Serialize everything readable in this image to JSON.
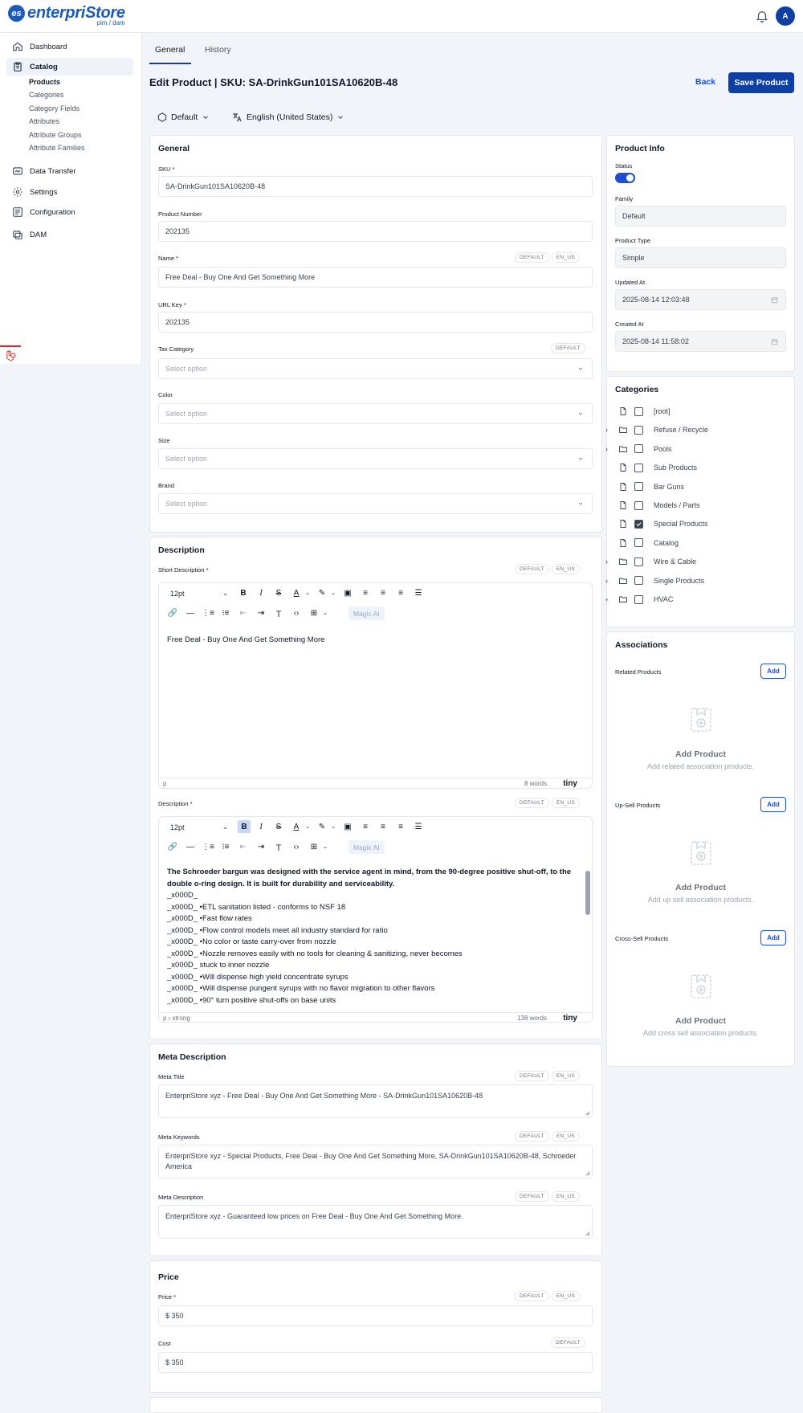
{
  "brand": {
    "name": "enterpriStore",
    "sub": "pim / dam",
    "mark": "es"
  },
  "user": {
    "initial": "A"
  },
  "sidebar": {
    "items": [
      {
        "label": "Dashboard",
        "icon": "home-icon"
      },
      {
        "label": "Catalog",
        "icon": "clipboard-icon"
      },
      {
        "label": "Data Transfer",
        "icon": "transfer-icon"
      },
      {
        "label": "Settings",
        "icon": "gear-icon"
      },
      {
        "label": "Configuration",
        "icon": "sliders-icon"
      },
      {
        "label": "DAM",
        "icon": "images-icon"
      }
    ],
    "catalog_sub": [
      "Products",
      "Categories",
      "Category Fields",
      "Attributes",
      "Attribute Groups",
      "Attribute Families"
    ]
  },
  "tabs": [
    "General",
    "History"
  ],
  "page": {
    "title": "Edit Product | SKU: SA-DrinkGun101SA10620B-48",
    "back": "Back",
    "save": "Save Product",
    "channel": "Default",
    "locale": "English (United States)"
  },
  "badges": {
    "default": "DEFAULT",
    "locale": "EN_US"
  },
  "general": {
    "title": "General",
    "sku_label": "SKU *",
    "sku": "SA-DrinkGun101SA10620B-48",
    "number_label": "Product Number",
    "number": "202135",
    "name_label": "Name *",
    "name": "Free Deal - Buy One And Get Something More",
    "url_label": "URL Key *",
    "url": "202135",
    "tax_label": "Tax Category",
    "color_label": "Color",
    "size_label": "Size",
    "brand_label": "Brand",
    "placeholder": "Select option"
  },
  "description": {
    "title": "Description",
    "short_label": "Short Description *",
    "font_size": "12pt",
    "magic": "Magic AI",
    "short_text": "Free Deal - Buy One And Get Something More",
    "short_path": "p",
    "short_words": "8 words",
    "long_label": "Description *",
    "long_bold": "The Schroeder bargun was designed with the service agent in mind, from the 90-degree positive shut-off, to the double o-ring design. It is built for durability and serviceability.",
    "long_lines": [
      "_x000D_",
      "_x000D_ •ETL sanitation listed - conforms to NSF 18",
      "_x000D_ •Fast flow rates",
      "_x000D_ •Flow control models meet all industry standard for ratio",
      "_x000D_ •No color or taste carry-over from nozzle",
      "_x000D_ •Nozzle removes easily with no tools for cleaning & sanitizing, never becomes",
      "_x000D_ stuck to inner nozzle",
      "_x000D_ •Will dispense high yield concentrate syrups",
      "_x000D_ •Will dispense pungent syrups with no flavor migration to other flavors",
      "_x000D_ •90° turn positive shut-offs on base units"
    ],
    "long_path": "p › strong",
    "long_words": "138 words",
    "tiny": "tiny"
  },
  "meta": {
    "title": "Meta Description",
    "title_label": "Meta Title",
    "title_value": "EnterpriStore xyz - Free Deal - Buy One And Get Something More - SA-DrinkGun101SA10620B-48",
    "keywords_label": "Meta Keywords",
    "keywords_value": "EnterpriStore xyz - Special Products,  Free Deal - Buy One And Get Something More, SA-DrinkGun101SA10620B-48, Schroeder America",
    "desc_label": "Meta Description",
    "desc_value": "EnterpriStore xyz - Guaranteed low prices on Free Deal - Buy One And Get Something More."
  },
  "price": {
    "title": "Price",
    "price_label": "Price *",
    "price_value": "$  350",
    "cost_label": "Cost",
    "cost_value": "$  350"
  },
  "product_info": {
    "title": "Product Info",
    "status_label": "Status",
    "status_on": true,
    "family_label": "Family",
    "family": "Default",
    "type_label": "Product Type",
    "type": "Simple",
    "updated_label": "Updated At",
    "updated": "2025-08-14 12:03:48",
    "created_label": "Created At",
    "created": "2025-08-14 11:58:02"
  },
  "categories": {
    "title": "Categories",
    "items": [
      {
        "label": "[root]",
        "folder": false,
        "checked": false
      },
      {
        "label": "Refuse / Recycle",
        "folder": true,
        "checked": false
      },
      {
        "label": "Pools",
        "folder": true,
        "checked": false
      },
      {
        "label": "Sub Products",
        "folder": false,
        "checked": false
      },
      {
        "label": "Bar Guns",
        "folder": false,
        "checked": false
      },
      {
        "label": "Models / Parts",
        "folder": false,
        "checked": false
      },
      {
        "label": "Special Products",
        "folder": false,
        "checked": true
      },
      {
        "label": "Catalog",
        "folder": false,
        "checked": false
      },
      {
        "label": "Wire & Cable",
        "folder": true,
        "checked": false
      },
      {
        "label": "Single Products",
        "folder": true,
        "checked": false
      },
      {
        "label": "HVAC",
        "folder": true,
        "checked": false
      }
    ]
  },
  "associations": {
    "title": "Associations",
    "add": "Add",
    "empty_title": "Add Product",
    "groups": [
      {
        "label": "Related Products",
        "empty_sub": "Add related association products."
      },
      {
        "label": "Up-Sell Products",
        "empty_sub": "Add up sell association products."
      },
      {
        "label": "Cross-Sell Products",
        "empty_sub": "Add cross sell association products."
      }
    ]
  },
  "colors": {
    "accent": "#0e3fa3",
    "link": "#1d4ed8",
    "brand": "#1c5bb8"
  }
}
